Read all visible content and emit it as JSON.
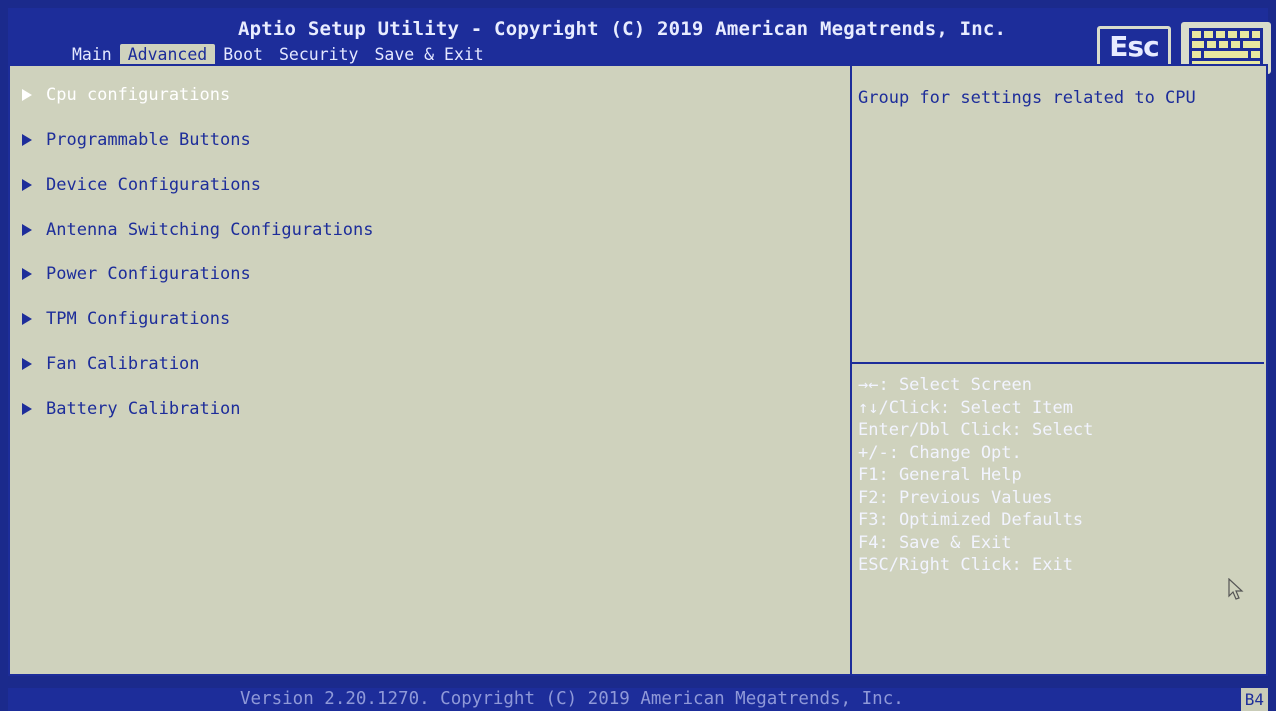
{
  "header": {
    "title": "Aptio Setup Utility - Copyright (C) 2019 American Megatrends, Inc.",
    "tabs": [
      {
        "label": "Main",
        "active": false
      },
      {
        "label": "Advanced",
        "active": true
      },
      {
        "label": "Boot",
        "active": false
      },
      {
        "label": "Security",
        "active": false
      },
      {
        "label": "Save & Exit",
        "active": false
      }
    ],
    "esc_label": "Esc",
    "keyboard_icon": "keyboard-icon"
  },
  "menu": {
    "items": [
      {
        "label": "Cpu configurations",
        "selected": true
      },
      {
        "label": "Programmable Buttons",
        "selected": false
      },
      {
        "label": "Device Configurations",
        "selected": false
      },
      {
        "label": "Antenna Switching Configurations",
        "selected": false
      },
      {
        "label": "Power Configurations",
        "selected": false
      },
      {
        "label": "TPM Configurations",
        "selected": false
      },
      {
        "label": "Fan Calibration",
        "selected": false
      },
      {
        "label": "Battery Calibration",
        "selected": false
      }
    ],
    "arrow_icon": "submenu-arrow-icon"
  },
  "help": {
    "description": "Group for settings related to CPU",
    "keys": [
      "→←: Select Screen",
      "↑↓/Click: Select Item",
      "Enter/Dbl Click: Select",
      "+/-: Change Opt.",
      "F1: General Help",
      "F2: Previous Values",
      "F3: Optimized Defaults",
      "F4: Save & Exit",
      "ESC/Right Click: Exit"
    ]
  },
  "footer": {
    "version": "Version 2.20.1270. Copyright (C) 2019 American Megatrends, Inc.",
    "post_code": "B4"
  },
  "colors": {
    "background_blue": "#1d2d9a",
    "panel_beige": "#cfd2bd",
    "text_blue": "#1d2d9a",
    "text_white": "#f2f4ff"
  }
}
